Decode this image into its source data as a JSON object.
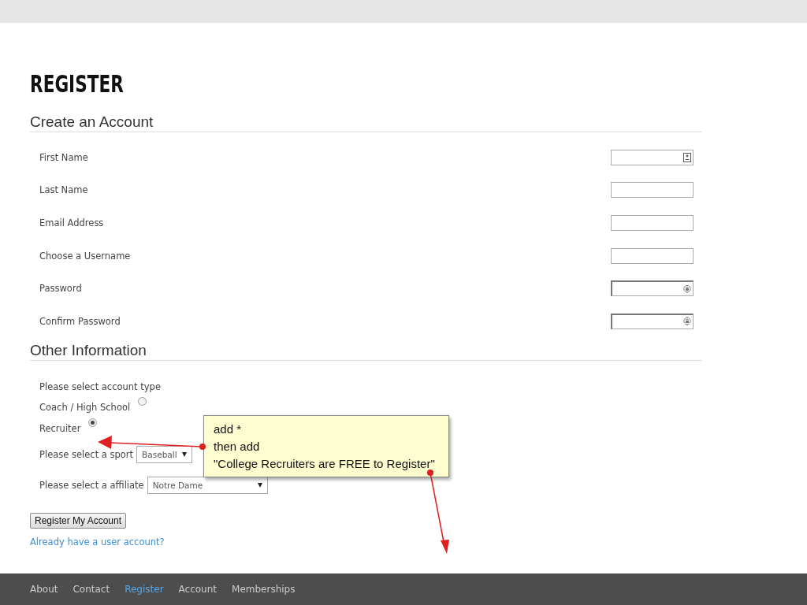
{
  "page": {
    "title": "REGISTER"
  },
  "account_section": {
    "heading": "Create an Account",
    "fields": [
      {
        "label": "First Name",
        "kind": "contact"
      },
      {
        "label": "Last Name",
        "kind": "plain"
      },
      {
        "label": "Email Address",
        "kind": "plain"
      },
      {
        "label": "Choose a Username",
        "kind": "plain"
      },
      {
        "label": "Password",
        "kind": "password"
      },
      {
        "label": "Confirm Password",
        "kind": "password"
      }
    ]
  },
  "other_section": {
    "heading": "Other Information",
    "account_type_prompt": "Please select account type",
    "account_types": [
      {
        "label": "Coach / High School",
        "selected": false
      },
      {
        "label": "Recruiter",
        "selected": true
      }
    ],
    "sport": {
      "label": "Please select a sport",
      "value": "Baseball"
    },
    "affiliate": {
      "label": "Please select a affiliate",
      "value": "Notre Dame"
    }
  },
  "submit_button": "Register My Account",
  "login_link": "Already have a user account?",
  "annotation": {
    "lines": [
      "add *",
      "then add",
      "\"College Recruiters are FREE to Register\""
    ]
  },
  "footer_nav": [
    {
      "label": "About",
      "selected": false
    },
    {
      "label": "Contact",
      "selected": false
    },
    {
      "label": "Register",
      "selected": true
    },
    {
      "label": "Account",
      "selected": false
    },
    {
      "label": "Memberships",
      "selected": false
    }
  ]
}
